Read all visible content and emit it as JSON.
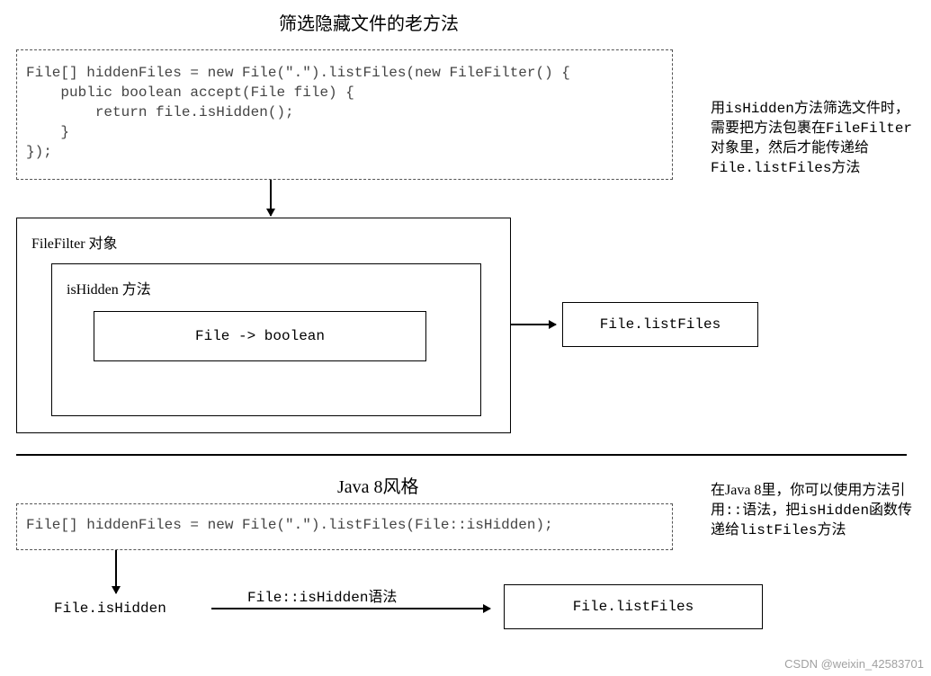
{
  "section1": {
    "title": "筛选隐藏文件的老方法",
    "code": "File[] hiddenFiles = new File(\".\").listFiles(new FileFilter() {\n    public boolean accept(File file) {\n        return file.isHidden();\n    }\n});",
    "note_parts": {
      "p1": "用",
      "m1": "isHidden",
      "p2": "方法筛选文件时，需要把方法包裹在",
      "m2": "FileFilter",
      "p3": "对象里，然后才能传递给",
      "m3": "File.listFiles",
      "p4": "方法"
    },
    "filefilter_label": "FileFilter 对象",
    "ishidden_label": "isHidden 方法",
    "file_boolean": "File -> boolean",
    "listfiles": "File.listFiles"
  },
  "section2": {
    "title": "Java 8风格",
    "code": "File[] hiddenFiles = new File(\".\").listFiles(File::isHidden);",
    "note_parts": {
      "p1": "在Java 8里，你可以使用方法引用",
      "m1": "::",
      "p2": "语法，把",
      "m2": "isHidden",
      "p3": "函数传递给",
      "m3": "listFiles",
      "p4": "方法"
    },
    "bottom_left": "File.isHidden",
    "arrow_mono": "File::isHidden",
    "arrow_tail": "语法",
    "listfiles": "File.listFiles"
  },
  "watermark": "CSDN @weixin_42583701"
}
